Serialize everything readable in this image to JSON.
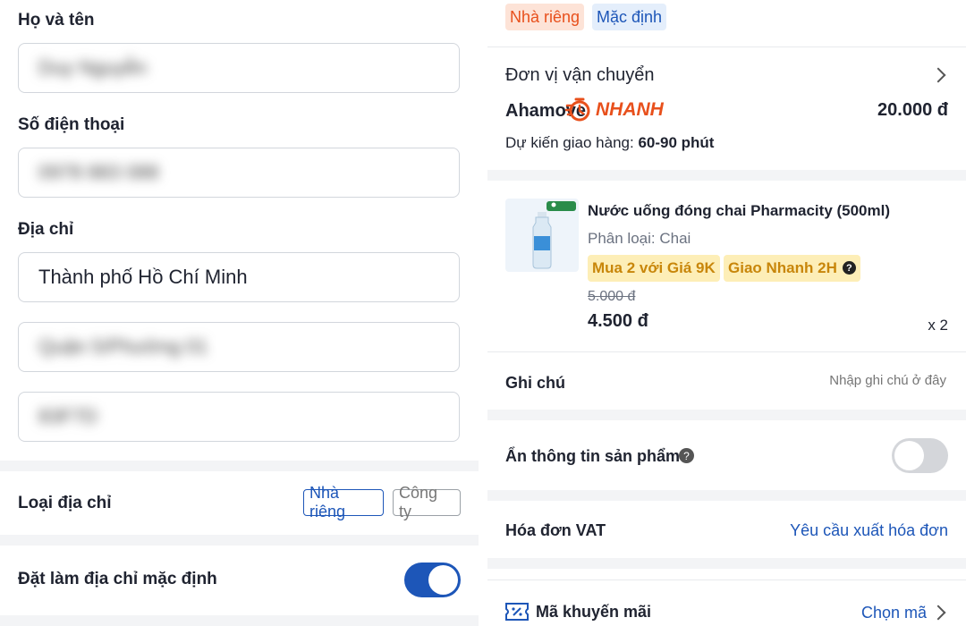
{
  "form": {
    "name_label": "Họ và tên",
    "name_value": "Duy Nguyễn",
    "phone_label": "Số điện thoại",
    "phone_value": "0978 883 088",
    "address_label": "Địa chỉ",
    "city_value": "Thành phố Hồ Chí Minh",
    "district_value": "Quận 5/Phường 01",
    "street_value": "83F7D",
    "address_type_label": "Loại địa chỉ",
    "type_home": "Nhà riêng",
    "type_company": "Công ty",
    "default_label": "Đặt làm địa chỉ mặc định",
    "default_on": true
  },
  "summary": {
    "tag_home": "Nhà riêng",
    "tag_default": "Mặc định",
    "shipping_title": "Đơn vị vận chuyển",
    "carrier_name": "Ahamove",
    "carrier_badge": "NHANH",
    "shipping_fee": "20.000 đ",
    "eta_label": "Dự kiến giao hàng:",
    "eta_value": "60-90 phút",
    "product": {
      "name": "Nước uống đóng chai Pharmacity (500ml)",
      "variant": "Phân loại: Chai",
      "promo_1": "Mua 2 với Giá 9K",
      "promo_2": "Giao Nhanh 2H",
      "old_price": "5.000 đ",
      "price": "4.500 đ",
      "qty": "x 2"
    },
    "note_label": "Ghi chú",
    "note_placeholder": "Nhập ghi chú ở đây",
    "hide_info_label": "Ẩn thông tin sản phẩm",
    "hide_info_on": false,
    "vat_label": "Hóa đơn VAT",
    "vat_action": "Yêu cầu xuất hóa đơn",
    "promo_label": "Mã khuyến mãi",
    "promo_action": "Chọn mã"
  },
  "colors": {
    "primary_blue": "#1d56b8",
    "orange": "#e8501c",
    "promo_yellow_bg": "#fdeeb7",
    "promo_yellow_text": "#c8860a"
  }
}
